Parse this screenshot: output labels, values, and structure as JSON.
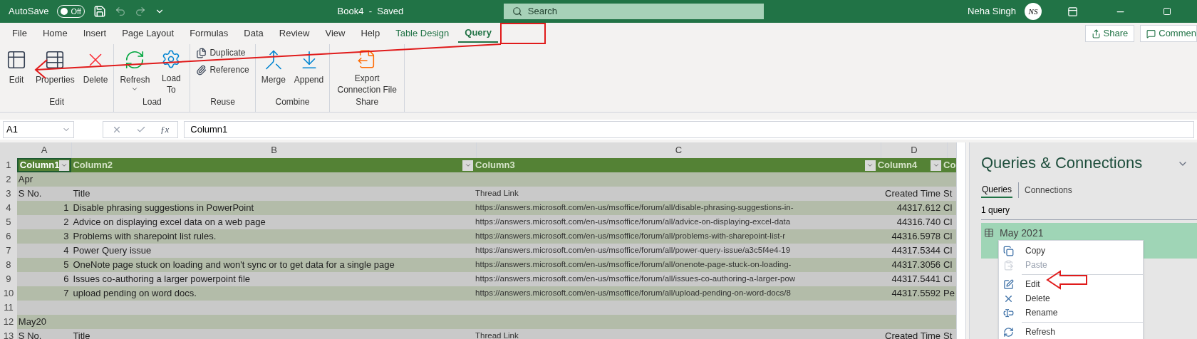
{
  "title_bar": {
    "autosave_label": "AutoSave",
    "autosave_toggle": {
      "label": "Off",
      "on": false
    },
    "document_title": "Book4  -  Saved",
    "search_placeholder": "Search",
    "user_name": "Neha Singh",
    "avatar_initials": "NS"
  },
  "ribbon_tabs": [
    {
      "label": "File",
      "selected": false,
      "kind": "normal"
    },
    {
      "label": "Home",
      "selected": false,
      "kind": "normal"
    },
    {
      "label": "Insert",
      "selected": false,
      "kind": "normal"
    },
    {
      "label": "Page Layout",
      "selected": false,
      "kind": "normal"
    },
    {
      "label": "Formulas",
      "selected": false,
      "kind": "normal"
    },
    {
      "label": "Data",
      "selected": false,
      "kind": "normal"
    },
    {
      "label": "Review",
      "selected": false,
      "kind": "normal"
    },
    {
      "label": "View",
      "selected": false,
      "kind": "normal"
    },
    {
      "label": "Help",
      "selected": false,
      "kind": "normal"
    },
    {
      "label": "Table Design",
      "selected": false,
      "kind": "contextual"
    },
    {
      "label": "Query",
      "selected": true,
      "kind": "contextual"
    }
  ],
  "share_button": "Share",
  "comments_button": "Commen",
  "ribbon_groups": [
    {
      "label": "Edit",
      "kind": "large",
      "commands": [
        {
          "label": "Edit",
          "kind": "edit"
        },
        {
          "label": "Properties",
          "kind": "properties"
        },
        {
          "label": "Delete",
          "kind": "delete"
        }
      ]
    },
    {
      "label": "Load",
      "kind": "large",
      "commands": [
        {
          "label": "Refresh",
          "kind": "refresh",
          "dropdown": true
        },
        {
          "label": "Load To",
          "kind": "load"
        }
      ]
    },
    {
      "label": "Reuse",
      "kind": "stacked",
      "commands": [
        {
          "label": "Duplicate",
          "kind": "duplicate"
        },
        {
          "label": "Reference",
          "kind": "reference"
        }
      ]
    },
    {
      "label": "Combine",
      "kind": "large",
      "commands": [
        {
          "label": "Merge",
          "kind": "merge"
        },
        {
          "label": "Append",
          "kind": "append"
        }
      ]
    },
    {
      "label": "Share",
      "kind": "large",
      "commands": [
        {
          "label": "Export Connection File",
          "kind": "export"
        }
      ]
    }
  ],
  "formula_bar": {
    "name_box": "A1",
    "function_button": "ƒx",
    "value": "Column1"
  },
  "sheet": {
    "column_letters": [
      "A",
      "B",
      "C",
      "D"
    ],
    "header_row": {
      "number": "1",
      "cells": [
        {
          "text": "Column1",
          "selected": true
        },
        {
          "text": "Column2",
          "selected": false
        },
        {
          "text": "Column3",
          "selected": false
        },
        {
          "text": "Column4",
          "selected": false
        },
        {
          "text": "Co",
          "selected": false
        }
      ]
    },
    "rows": [
      {
        "number": "2",
        "cells": [
          "Apr",
          "",
          "",
          "",
          ""
        ]
      },
      {
        "number": "3",
        "cells": [
          "S No.",
          "Title",
          "Thread Link",
          "Created Time",
          "St"
        ]
      },
      {
        "number": "4",
        "cells": [
          "1",
          "Disable phrasing suggestions in PowerPoint",
          "https://answers.microsoft.com/en-us/msoffice/forum/all/disable-phrasing-suggestions-in-",
          "44317.612",
          "Cl"
        ]
      },
      {
        "number": "5",
        "cells": [
          "2",
          "Advice on displaying excel data on a web page",
          "https://answers.microsoft.com/en-us/msoffice/forum/all/advice-on-displaying-excel-data",
          "44316.740",
          "Cl"
        ]
      },
      {
        "number": "6",
        "cells": [
          "3",
          "Problems with sharepoint list rules.",
          "https://answers.microsoft.com/en-us/msoffice/forum/all/problems-with-sharepoint-list-r",
          "44316.5978",
          "Cl"
        ]
      },
      {
        "number": "7",
        "cells": [
          "4",
          "Power Query issue",
          "https://answers.microsoft.com/en-us/msoffice/forum/all/power-query-issue/a3c5f4e4-19",
          "44317.5344",
          "Cl"
        ]
      },
      {
        "number": "8",
        "cells": [
          "5",
          "OneNote page stuck on loading and won't sync or to get data for a single page",
          "https://answers.microsoft.com/en-us/msoffice/forum/all/onenote-page-stuck-on-loading-",
          "44317.3056",
          "Cl"
        ]
      },
      {
        "number": "9",
        "cells": [
          "6",
          "Issues co-authoring a larger powerpoint file",
          "https://answers.microsoft.com/en-us/msoffice/forum/all/issues-co-authoring-a-larger-pow",
          "44317.5441",
          "Cl"
        ]
      },
      {
        "number": "10",
        "cells": [
          "7",
          "upload pending on word docs.",
          "https://answers.microsoft.com/en-us/msoffice/forum/all/upload-pending-on-word-docs/8",
          "44317.5592",
          "Pe"
        ]
      },
      {
        "number": "11",
        "cells": [
          "",
          "",
          "",
          "",
          ""
        ]
      },
      {
        "number": "12",
        "cells": [
          "May20",
          "",
          "",
          "",
          ""
        ]
      },
      {
        "number": "13",
        "cells": [
          "S No.",
          "Title",
          "Thread Link",
          "Created Time",
          "St"
        ]
      }
    ]
  },
  "queries_pane": {
    "title": "Queries & Connections",
    "tabs": [
      {
        "label": "Queries",
        "selected": true
      },
      {
        "label": "Connections",
        "selected": false
      }
    ],
    "count": "1 query",
    "items": [
      {
        "name": "May 2021",
        "selected": true
      }
    ],
    "context_menu": [
      [
        {
          "label": "Copy",
          "kind": "copy",
          "disabled": false
        },
        {
          "label": "Paste",
          "kind": "paste",
          "disabled": true
        }
      ],
      [
        {
          "label": "Edit",
          "kind": "edit",
          "disabled": false
        },
        {
          "label": "Delete",
          "kind": "delete",
          "disabled": false
        },
        {
          "label": "Rename",
          "kind": "rename",
          "disabled": false
        }
      ],
      [
        {
          "label": "Refresh",
          "kind": "refresh",
          "disabled": false
        }
      ]
    ]
  }
}
